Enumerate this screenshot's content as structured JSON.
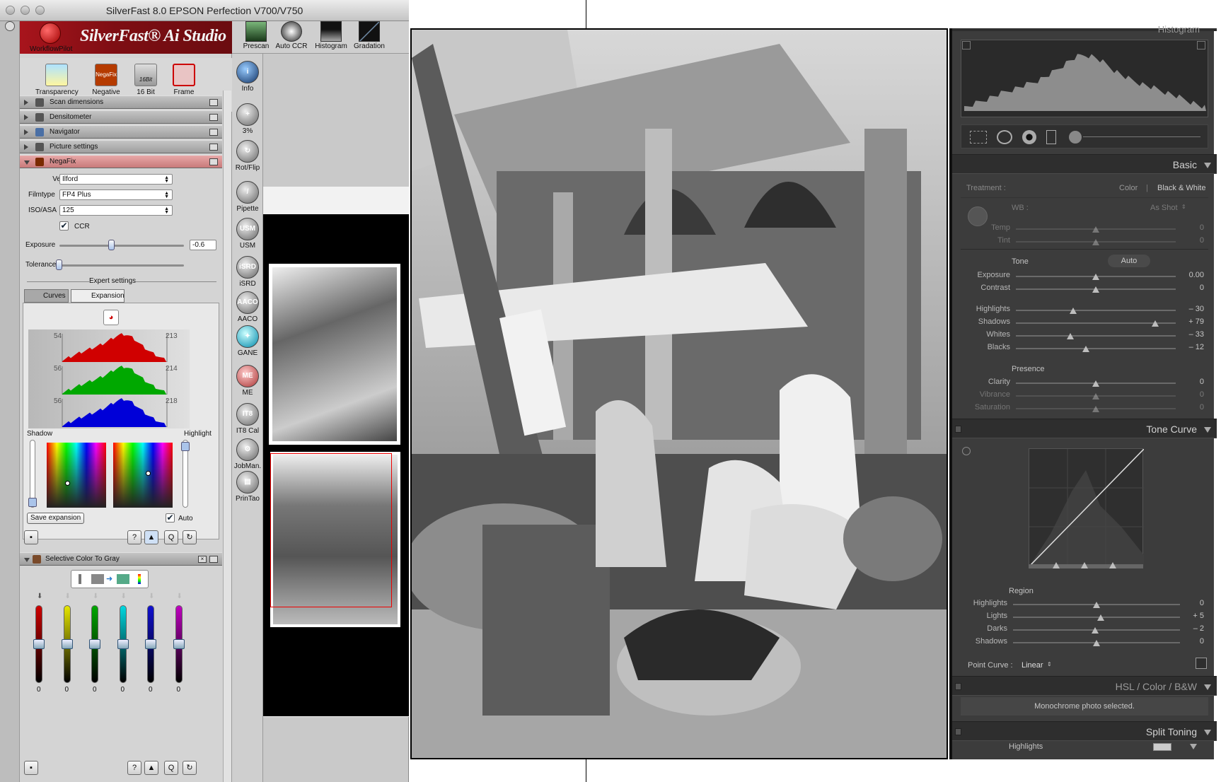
{
  "window": {
    "title": "SilverFast 8.0 EPSON Perfection V700/V750"
  },
  "logo": {
    "brand": "SilverFast® Ai Studio",
    "workflow_label": "WorkflowPilot"
  },
  "top_icons": [
    "Transparency",
    "Negative",
    "16 Bit",
    "Frame"
  ],
  "top_icon_badges": {
    "negative": "NegaFix",
    "bit": "16Bit"
  },
  "toolbar_top": [
    "Prescan",
    "Auto CCR",
    "Histogram",
    "Gradation"
  ],
  "sections": [
    "Scan dimensions",
    "Densitometer",
    "Navigator",
    "Picture settings",
    "NegaFix"
  ],
  "negafix": {
    "vendor_label": "Vendor",
    "vendor_value": "Ilford",
    "filmtype_label": "Filmtype",
    "filmtype_value": "FP4 Plus",
    "iso_label": "ISO/ASA",
    "iso_value": "125",
    "ccr_label": "CCR",
    "exposure_label": "Exposure",
    "exposure_value": "-0.6",
    "tolerance_label": "Tolerance",
    "expert_label": "Expert settings"
  },
  "expansion": {
    "tab_curves": "Curves",
    "tab_expansion": "Expansion",
    "hist": [
      {
        "left": "54",
        "right": "213",
        "color": "#d00000"
      },
      {
        "left": "56",
        "right": "214",
        "color": "#00a800"
      },
      {
        "left": "56",
        "right": "218",
        "color": "#0000d8"
      }
    ],
    "shadow_label": "Shadow",
    "highlight_label": "Highlight",
    "save_label": "Save expansion",
    "auto_label": "Auto"
  },
  "selective": {
    "title": "Selective Color To Gray",
    "sliders": [
      {
        "color": "#d00000",
        "value": "0"
      },
      {
        "color": "#e6e600",
        "value": "0"
      },
      {
        "color": "#00a800",
        "value": "0"
      },
      {
        "color": "#00d8e0",
        "value": "0"
      },
      {
        "color": "#1010d0",
        "value": "0"
      },
      {
        "color": "#c000c0",
        "value": "0"
      }
    ]
  },
  "tools": [
    {
      "label": "Info",
      "icon": "i"
    },
    {
      "label": "3%",
      "icon": "+"
    },
    {
      "label": "Rot/Flip",
      "icon": "↻"
    },
    {
      "label": "Pipette",
      "icon": "/"
    },
    {
      "label": "USM",
      "icon": "USM"
    },
    {
      "label": "iSRD",
      "icon": "iSRD"
    },
    {
      "label": "AACO",
      "icon": "AACO"
    },
    {
      "label": "GANE",
      "icon": "✦"
    },
    {
      "label": "ME",
      "icon": "ME"
    },
    {
      "label": "IT8 Cal",
      "icon": "IT8"
    },
    {
      "label": "JobMan.",
      "icon": "⚙"
    },
    {
      "label": "PrinTao",
      "icon": "▤"
    }
  ],
  "lr": {
    "histogram_title": "Histogram",
    "basic": "Basic",
    "treatment_label": "Treatment :",
    "treatment_color": "Color",
    "treatment_sep": "|",
    "treatment_bw": "Black & White",
    "wb_label": "WB :",
    "wb_value": "As Shot",
    "temp_label": "Temp",
    "temp_value": "0",
    "tint_label": "Tint",
    "tint_value": "0",
    "tone_label": "Tone",
    "auto_label": "Auto",
    "exposure_label": "Exposure",
    "exposure_value": "0.00",
    "contrast_label": "Contrast",
    "contrast_value": "0",
    "highlights_label": "Highlights",
    "highlights_value": "– 30",
    "shadows_label": "Shadows",
    "shadows_value": "+ 79",
    "whites_label": "Whites",
    "whites_value": "– 33",
    "blacks_label": "Blacks",
    "blacks_value": "– 12",
    "presence_label": "Presence",
    "clarity_label": "Clarity",
    "clarity_value": "0",
    "vibrance_label": "Vibrance",
    "vibrance_value": "0",
    "saturation_label": "Saturation",
    "saturation_value": "0",
    "tonecurve": "Tone Curve",
    "region_label": "Region",
    "r_highlights_label": "Highlights",
    "r_highlights_value": "0",
    "r_lights_label": "Lights",
    "r_lights_value": "+ 5",
    "r_darks_label": "Darks",
    "r_darks_value": "– 2",
    "r_shadows_label": "Shadows",
    "r_shadows_value": "0",
    "point_curve_label": "Point Curve :",
    "point_curve_value": "Linear",
    "hsl": "HSL  /  Color  /  B&W",
    "mono_msg": "Monochrome photo selected.",
    "split": "Split Toning",
    "split_highlights": "Highlights"
  }
}
